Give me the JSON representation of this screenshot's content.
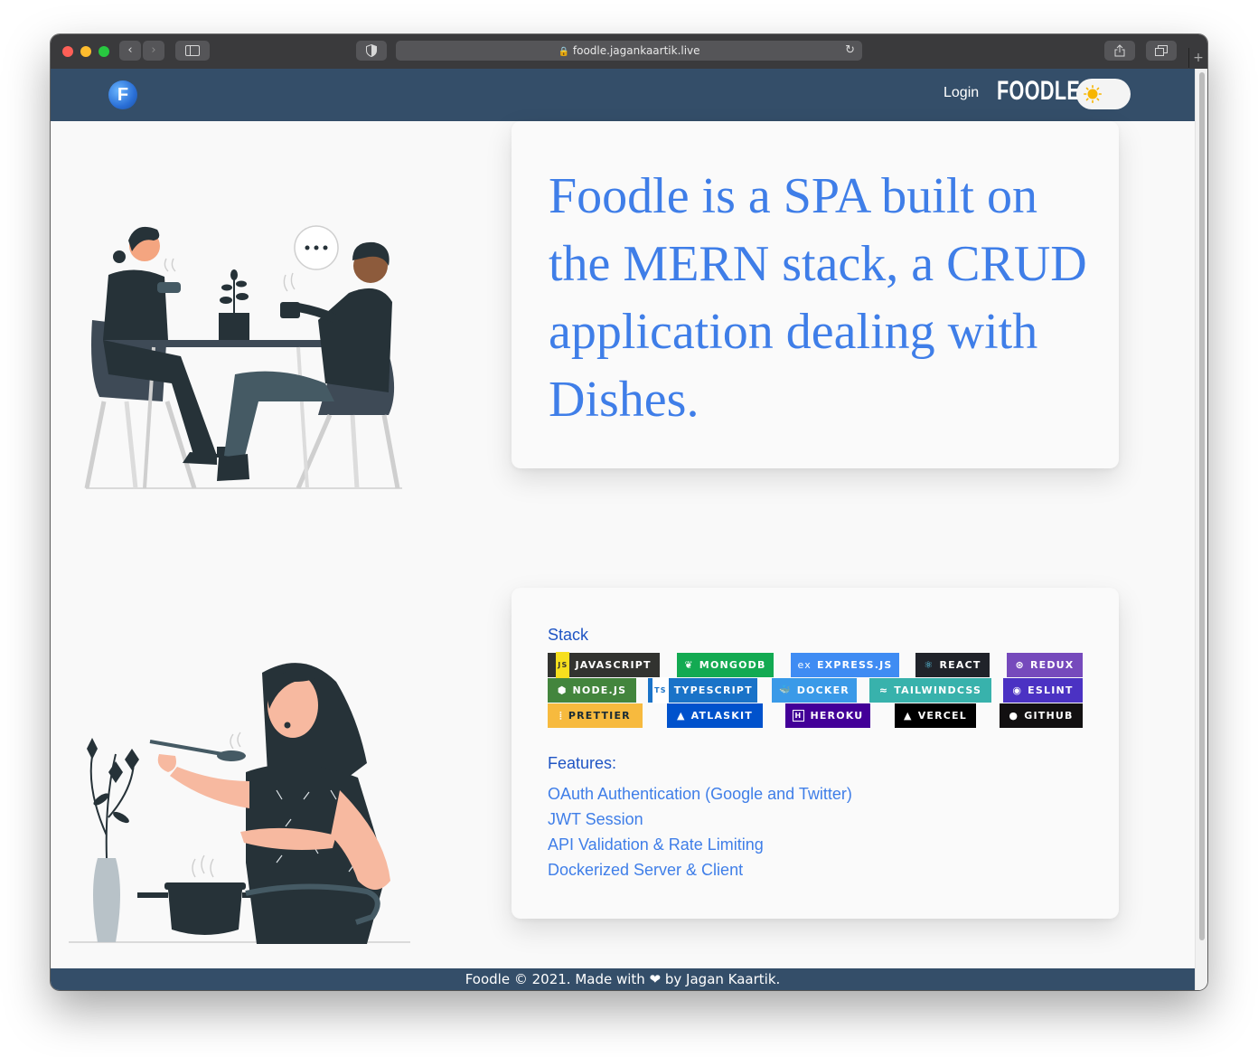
{
  "browser": {
    "url": "foodle.jagankaartik.live",
    "back_icon": "chevron-left-icon",
    "forward_icon": "chevron-right-icon",
    "sidebar_icon": "sidebar-icon",
    "shield_icon": "shield-icon",
    "reload_icon": "reload-icon",
    "share_icon": "share-icon",
    "tabs_icon": "tabs-icon"
  },
  "navbar": {
    "logo_letter": "F",
    "login_label": "Login",
    "brand": "FOODLE",
    "theme_toggle_icon": "sun-icon"
  },
  "hero": {
    "text": "Foodle is a SPA built on the MERN stack, a CRUD application dealing with Dishes."
  },
  "stack": {
    "title": "Stack",
    "badges": [
      {
        "label": "JAVASCRIPT",
        "icon": "JS",
        "color": "#323330"
      },
      {
        "label": "MONGODB",
        "icon": "❦",
        "color": "#13aa52"
      },
      {
        "label": "EXPRESS.JS",
        "icon": "ex",
        "color": "#3f8cf3"
      },
      {
        "label": "REACT",
        "icon": "⚛",
        "color": "#20232a"
      },
      {
        "label": "REDUX",
        "icon": "⊛",
        "color": "#764abc"
      },
      {
        "label": "NODE.JS",
        "icon": "⬢",
        "color": "#43853d"
      },
      {
        "label": "TYPESCRIPT",
        "icon": "TS",
        "color": "#1a73c8"
      },
      {
        "label": "DOCKER",
        "icon": "🐳",
        "color": "#3a9ae8"
      },
      {
        "label": "TAILWINDCSS",
        "icon": "≈",
        "color": "#38b2ac"
      },
      {
        "label": "ESLINT",
        "icon": "◉",
        "color": "#4b32c3"
      },
      {
        "label": "PRETTIER",
        "icon": "⦙",
        "color": "#f7ba3e"
      },
      {
        "label": "ATLASKIT",
        "icon": "▲",
        "color": "#0052cc"
      },
      {
        "label": "HEROKU",
        "icon": "H",
        "color": "#430098"
      },
      {
        "label": "VERCEL",
        "icon": "▲",
        "color": "#000000"
      },
      {
        "label": "GITHUB",
        "icon": "●",
        "color": "#121011"
      }
    ]
  },
  "features": {
    "title": "Features:",
    "items": [
      "OAuth Authentication (Google and Twitter)",
      "JWT Session",
      "API Validation & Rate Limiting",
      "Dockerized Server & Client"
    ]
  },
  "footer": {
    "text": "Foodle © 2021. Made with ❤ by Jagan Kaartik."
  },
  "colors": {
    "navbar": "#344e69",
    "accent_text": "#3f7ee8",
    "heading_text": "#1f55c4"
  }
}
